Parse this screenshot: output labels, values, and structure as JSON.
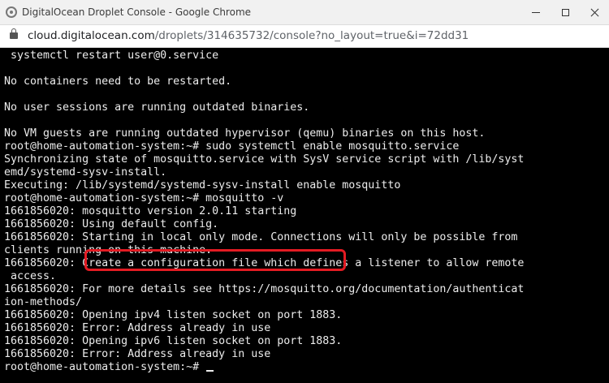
{
  "window": {
    "title": "DigitalOcean Droplet Console - Google Chrome",
    "app_icon": "chrome-app-icon",
    "controls": [
      "minimize",
      "maximize",
      "close"
    ]
  },
  "address_bar": {
    "host": "cloud.digitalocean.com",
    "path": "/droplets/314635732/console?no_layout=true&i=72dd31",
    "icon": "lock-icon"
  },
  "terminal": {
    "lines": [
      " systemctl restart user@0.service",
      "",
      "No containers need to be restarted.",
      "",
      "No user sessions are running outdated binaries.",
      "",
      "No VM guests are running outdated hypervisor (qemu) binaries on this host.",
      "root@home-automation-system:~# sudo systemctl enable mosquitto.service",
      "Synchronizing state of mosquitto.service with SysV service script with /lib/syst",
      "emd/systemd-sysv-install.",
      "Executing: /lib/systemd/systemd-sysv-install enable mosquitto",
      "root@home-automation-system:~# mosquitto -v",
      "1661856020: mosquitto version 2.0.11 starting",
      "1661856020: Using default config.",
      "1661856020: Starting in local only mode. Connections will only be possible from",
      "clients running on this machine.",
      "1661856020: Create a configuration file which defines a listener to allow remote",
      " access.",
      "1661856020: For more details see https://mosquitto.org/documentation/authenticat",
      "ion-methods/",
      "1661856020: Opening ipv4 listen socket on port 1883.",
      "1661856020: Error: Address already in use",
      "1661856020: Opening ipv6 listen socket on port 1883.",
      "1661856020: Error: Address already in use",
      "root@home-automation-system:~# "
    ],
    "highlight_color": "#e31b23"
  }
}
